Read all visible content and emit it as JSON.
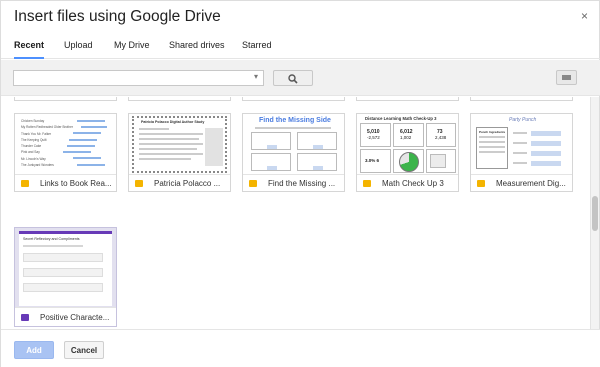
{
  "dialog": {
    "title": "Insert files using Google Drive",
    "close": "×"
  },
  "tabs": [
    {
      "label": "Recent",
      "active": true
    },
    {
      "label": "Upload"
    },
    {
      "label": "My Drive"
    },
    {
      "label": "Shared drives"
    },
    {
      "label": "Starred"
    }
  ],
  "search": {
    "value": "",
    "caret": "▾",
    "icon": "search-icon"
  },
  "view_toggle": {
    "icon": "list-view-icon"
  },
  "files": [
    {
      "name": "Links to Book Rea...",
      "type": "slides",
      "icon_color": "#f4b400",
      "thumb_lines": [
        "Chicken Sunday",
        "My Rotten Redheaded Older Brother",
        "Thank You Mr. Falker",
        "The Keeping Quilt",
        "Thunder Cake",
        "Pink and Say",
        "Mr. Lincoln's Way",
        "The Junkyard Wonders"
      ]
    },
    {
      "name": "Patricia Polacco ...",
      "type": "slides",
      "icon_color": "#f4b400",
      "thumb_title": "Patricia Polacco Digital Author Study"
    },
    {
      "name": "Find the Missing ...",
      "type": "slides",
      "icon_color": "#f4b400",
      "thumb_title": "Find the Missing Side"
    },
    {
      "name": "Math Check Up 3",
      "type": "slides",
      "icon_color": "#f4b400",
      "thumb_title": "Distance Learning Math Check-Up 3",
      "thumb_values": [
        "5,010",
        "6,012",
        "73",
        "-2,572",
        "1,002",
        "2,438",
        "3.0% 6"
      ]
    },
    {
      "name": "Measurement Dig...",
      "type": "slides",
      "icon_color": "#f4b400",
      "thumb_title": "Party Punch",
      "thumb_sub": "Punch Ingredients"
    },
    {
      "name": "Positive Characte...",
      "type": "forms",
      "icon_color": "#673ab7",
      "thumb_title": "Secret Reflectory and Compliments"
    }
  ],
  "footer": {
    "add": "Add",
    "cancel": "Cancel"
  },
  "colors": {
    "accent": "#4d90fe",
    "add_button": "#a9c3f3",
    "slides": "#f4b400",
    "forms": "#673ab7",
    "selected_card": "#e2e0ef"
  }
}
